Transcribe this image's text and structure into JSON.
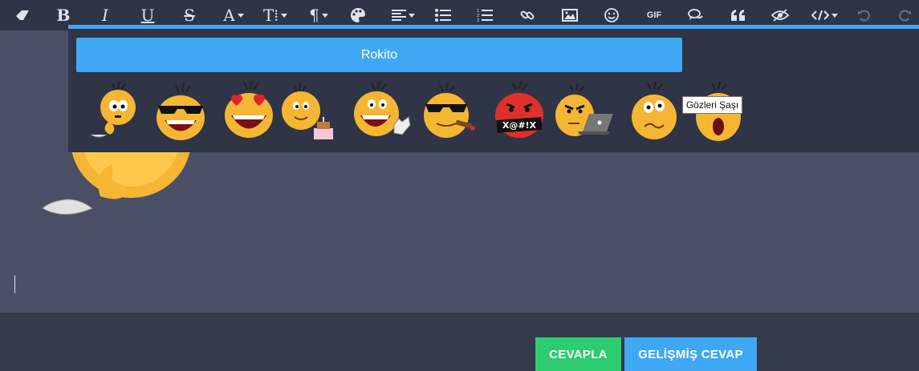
{
  "toolbar": {
    "items": [
      {
        "name": "eraser-icon"
      },
      {
        "name": "bold-icon",
        "glyph": "B"
      },
      {
        "name": "italic-icon",
        "glyph": "I"
      },
      {
        "name": "underline-icon",
        "glyph": "U"
      },
      {
        "name": "strikethrough-icon",
        "glyph": "S"
      },
      {
        "name": "font-color-icon",
        "glyph": "A"
      },
      {
        "name": "font-size-icon",
        "glyph": "T⁞"
      },
      {
        "name": "paragraph-icon",
        "glyph": "¶"
      },
      {
        "name": "palette-icon"
      },
      {
        "name": "align-icon"
      },
      {
        "name": "unordered-list-icon"
      },
      {
        "name": "ordered-list-icon"
      },
      {
        "name": "link-icon"
      },
      {
        "name": "image-icon"
      },
      {
        "name": "emoji-icon"
      },
      {
        "name": "gif-icon",
        "glyph": "GIF"
      },
      {
        "name": "comments-icon"
      },
      {
        "name": "quote-icon"
      },
      {
        "name": "spoiler-icon"
      },
      {
        "name": "code-icon"
      },
      {
        "name": "undo-icon"
      },
      {
        "name": "redo-icon"
      }
    ]
  },
  "emoji_popup": {
    "pack_label": "Rokito",
    "tooltip": "Gözleri Şaşı",
    "emojis": [
      {
        "name": "thinking-emoji"
      },
      {
        "name": "sunglasses-laugh-emoji"
      },
      {
        "name": "heart-eyes-emoji"
      },
      {
        "name": "birthday-cake-emoji"
      },
      {
        "name": "waving-laugh-emoji"
      },
      {
        "name": "cigar-cool-emoji"
      },
      {
        "name": "swearing-emoji",
        "text": "X@#!X"
      },
      {
        "name": "laptop-angry-emoji"
      },
      {
        "name": "worried-emoji"
      },
      {
        "name": "shocked-emoji"
      }
    ]
  },
  "actions": {
    "reply_label": "CEVAPLA",
    "advanced_label": "GELİŞMİŞ CEVAP"
  },
  "colors": {
    "accent": "#3fa8f5",
    "reply": "#2ecc71",
    "toolbar_bg": "#2f3446",
    "editor_bg": "#4b4f66"
  }
}
